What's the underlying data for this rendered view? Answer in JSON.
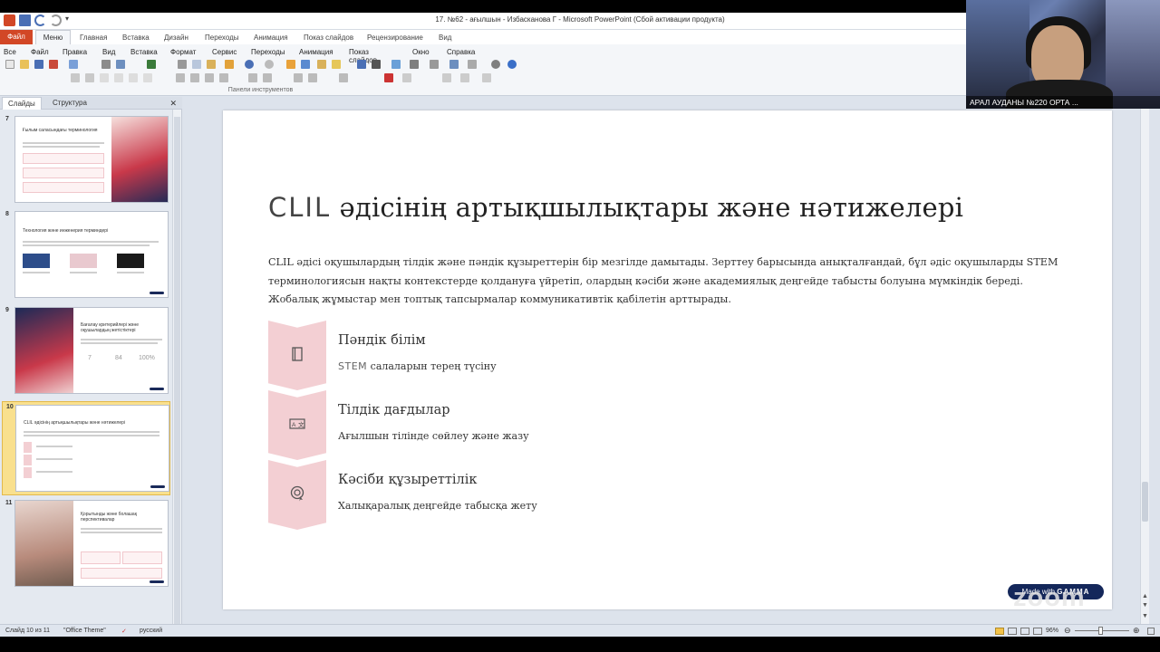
{
  "window": {
    "title": "17. №62 - ағылшын - Избасканова Г  -  Microsoft PowerPoint (Сбой активации продукта)"
  },
  "ribbon_tabs": [
    "Файл",
    "Меню",
    "Главная",
    "Вставка",
    "Дизайн",
    "Переходы",
    "Анимация",
    "Показ слайдов",
    "Рецензирование",
    "Вид"
  ],
  "menubar": [
    "Все",
    "Файл",
    "Правка",
    "Вид",
    "Вставка",
    "Формат",
    "Сервис",
    "Переходы",
    "Анимация",
    "Показ слайдов",
    "Окно",
    "Справка"
  ],
  "toolbar_caption": "Панели инструментов",
  "panel": {
    "tabs": [
      "Слайды",
      "Структура"
    ],
    "close_icon": "close-icon"
  },
  "thumbnails": [
    {
      "number": "7",
      "title": "Ғылым саласындағы терминология",
      "selected": false
    },
    {
      "number": "8",
      "title": "Технология және инженерия терминдері",
      "selected": false
    },
    {
      "number": "9",
      "title": "Бағалау критерийлері және оқушылардың жетістіктері",
      "selected": false,
      "stats": [
        "7",
        "84",
        "100%"
      ]
    },
    {
      "number": "10",
      "title": "CLIL әдісінің артықшылықтары және нәтижелері",
      "selected": true
    },
    {
      "number": "11",
      "title": "Қорытынды және болашақ перспективалар",
      "selected": false
    }
  ],
  "slide": {
    "title_prefix": "CLIL",
    "title_rest": " әдісінің артықшылықтары және нәтижелері",
    "body": "CLIL әдісі оқушылардың тілдік және пәндік құзыреттерін бір мезгілде дамытады. Зерттеу барысында анықталғандай, бұл әдіс оқушыларды STEM терминологиясын нақты контекстерде қолдануға үйретіп, олардың кәсіби және академиялық деңгейде табысты болуына мүмкіндік береді. Жобалық жұмыстар мен топтық тапсырмалар коммуникативтік қабілетін арттырады.",
    "features": [
      {
        "heading": "Пәндік білім",
        "sub_prefix": "STEM",
        "sub": " салаларын терең түсіну",
        "icon": "book-icon"
      },
      {
        "heading": "Тілдік дағдылар",
        "sub_prefix": "",
        "sub": "Ағылшын тілінде сөйлеу және жазу",
        "icon": "translate-icon"
      },
      {
        "heading": "Кәсіби құзыреттілік",
        "sub_prefix": "",
        "sub": "Халықаралық деңгейде табысқа жету",
        "icon": "badge-icon"
      }
    ],
    "badge": {
      "prefix": "Made with",
      "brand": "GAMMA"
    }
  },
  "statusbar": {
    "slide_info": "Слайд 10 из 11",
    "theme": "\"Office Theme\"",
    "language": "русский",
    "zoom": "96%"
  },
  "webcam": {
    "name": "АРАЛ АУДАНЫ №220 ОРТА ..."
  },
  "watermark": "zoom",
  "colors": {
    "accent_pink": "#f3cfd3",
    "file_tab": "#d24726",
    "gamma_badge": "#14275a",
    "selected_thumb": "#f9e08e"
  }
}
